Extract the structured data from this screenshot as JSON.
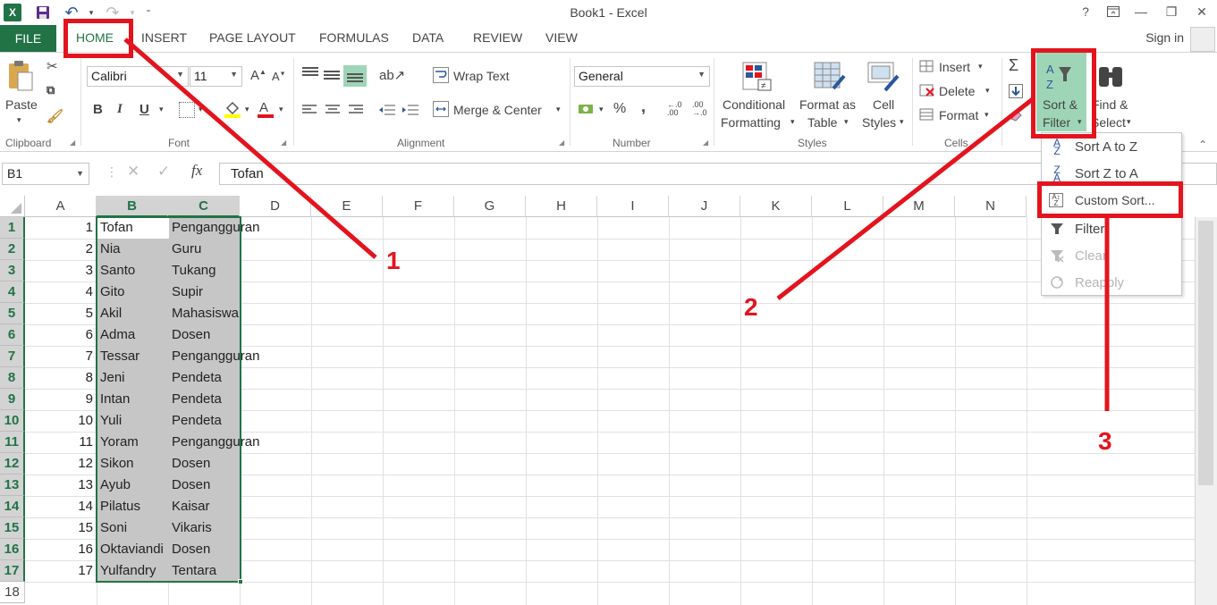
{
  "window": {
    "title": "Book1 - Excel",
    "help": "?",
    "signin": "Sign in"
  },
  "tabs": {
    "file": "FILE",
    "home": "HOME",
    "insert": "INSERT",
    "page_layout": "PAGE LAYOUT",
    "formulas": "FORMULAS",
    "data": "DATA",
    "review": "REVIEW",
    "view": "VIEW"
  },
  "ribbon": {
    "clipboard": {
      "paste": "Paste",
      "label": "Clipboard"
    },
    "font": {
      "name": "Calibri",
      "size": "11",
      "bold": "B",
      "italic": "I",
      "underline": "U",
      "label": "Font"
    },
    "alignment": {
      "wrap": "Wrap Text",
      "merge": "Merge & Center",
      "label": "Alignment"
    },
    "number": {
      "format": "General",
      "percent": "%",
      "comma": ",",
      "label": "Number"
    },
    "styles": {
      "cond1": "Conditional",
      "cond2": "Formatting",
      "fmt1": "Format as",
      "fmt2": "Table",
      "cell1": "Cell",
      "cell2": "Styles",
      "label": "Styles"
    },
    "cells": {
      "insert": "Insert",
      "delete": "Delete",
      "format": "Format",
      "label": "Cells"
    },
    "editing": {
      "sort1": "Sort &",
      "sort2": "Filter",
      "find1": "Find &",
      "find2": "Select"
    }
  },
  "formula_bar": {
    "name_box": "B1",
    "fx": "fx",
    "value": "Tofan"
  },
  "columns": [
    "A",
    "B",
    "C",
    "D",
    "E",
    "F",
    "G",
    "H",
    "I",
    "J",
    "K",
    "L",
    "M",
    "N"
  ],
  "rows": [
    {
      "n": "1",
      "a": "1",
      "b": "Tofan",
      "c": "Pengangguran"
    },
    {
      "n": "2",
      "a": "2",
      "b": "Nia",
      "c": "Guru"
    },
    {
      "n": "3",
      "a": "3",
      "b": "Santo",
      "c": "Tukang"
    },
    {
      "n": "4",
      "a": "4",
      "b": "Gito",
      "c": "Supir"
    },
    {
      "n": "5",
      "a": "5",
      "b": "Akil",
      "c": "Mahasiswa"
    },
    {
      "n": "6",
      "a": "6",
      "b": "Adma",
      "c": "Dosen"
    },
    {
      "n": "7",
      "a": "7",
      "b": "Tessar",
      "c": "Pengangguran"
    },
    {
      "n": "8",
      "a": "8",
      "b": "Jeni",
      "c": "Pendeta"
    },
    {
      "n": "9",
      "a": "9",
      "b": "Intan",
      "c": "Pendeta"
    },
    {
      "n": "10",
      "a": "10",
      "b": "Yuli",
      "c": "Pendeta"
    },
    {
      "n": "11",
      "a": "11",
      "b": "Yoram",
      "c": "Pengangguran"
    },
    {
      "n": "12",
      "a": "12",
      "b": "Sikon",
      "c": "Dosen"
    },
    {
      "n": "13",
      "a": "13",
      "b": "Ayub",
      "c": "Dosen"
    },
    {
      "n": "14",
      "a": "14",
      "b": "Pilatus",
      "c": "Kaisar"
    },
    {
      "n": "15",
      "a": "15",
      "b": "Soni",
      "c": "Vikaris"
    },
    {
      "n": "16",
      "a": "16",
      "b": "Oktaviandi",
      "c": "Dosen"
    },
    {
      "n": "17",
      "a": "17",
      "b": "Yulfandry",
      "c": "Tentara"
    }
  ],
  "extra_row": "18",
  "menu": {
    "sort_az": "Sort A to Z",
    "sort_za": "Sort Z to A",
    "custom_sort": "Custom Sort...",
    "filter": "Filter",
    "clear": "Clear",
    "reapply": "Reapply"
  },
  "annotations": [
    "1",
    "2",
    "3"
  ],
  "colors": {
    "excel_green": "#217346",
    "annotation_red": "#e3141e"
  }
}
